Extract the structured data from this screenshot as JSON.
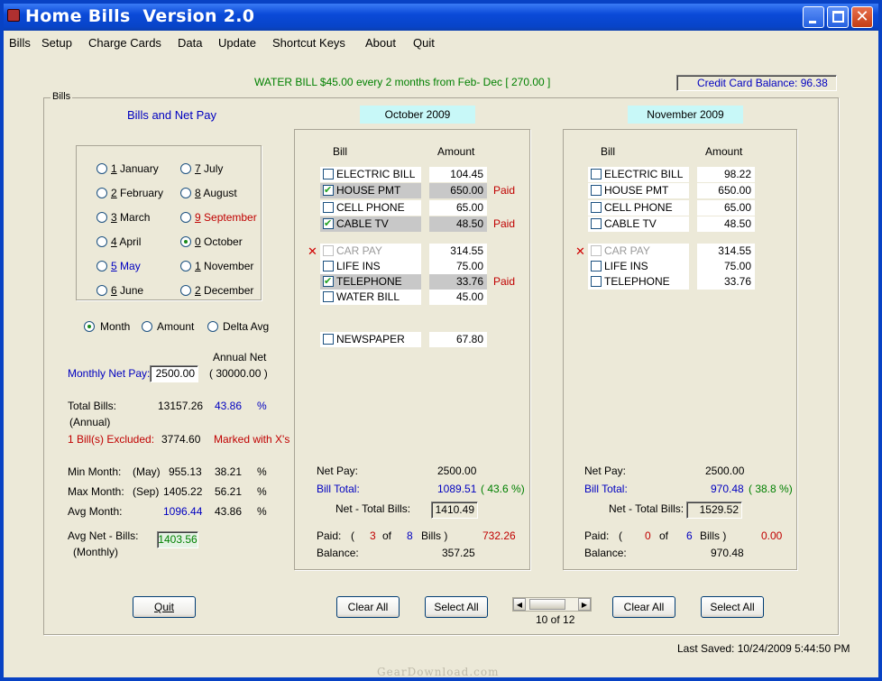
{
  "window": {
    "title": "Home Bills  Version 2.0"
  },
  "menu": [
    "Bills",
    "Setup",
    "Charge Cards",
    "Data",
    "Update",
    "Shortcut Keys",
    "About",
    "Quit"
  ],
  "reminder": "WATER BILL  $45.00  every 2 months from  Feb- Dec   [ 270.00 ]",
  "credit_card": "Credit Card Balance:  96.38",
  "bills_group_label": "Bills",
  "left": {
    "heading": "Bills and Net Pay",
    "months": [
      {
        "num": "1",
        "label": " January"
      },
      {
        "num": "2",
        "label": " February"
      },
      {
        "num": "3",
        "label": " March"
      },
      {
        "num": "4",
        "label": " April"
      },
      {
        "num": "5",
        "label": " May"
      },
      {
        "num": "6",
        "label": " June"
      },
      {
        "num": "7",
        "label": " July"
      },
      {
        "num": "8",
        "label": " August"
      },
      {
        "num": "9",
        "label": " September"
      },
      {
        "num": "0",
        "label": " October"
      },
      {
        "num": "1",
        "label": " November"
      },
      {
        "num": "2",
        "label": " December"
      }
    ],
    "sort_options": [
      "Month",
      "Amount",
      "Delta Avg"
    ],
    "annual_net_label": "Annual Net",
    "monthly_net_label": "Monthly Net Pay:",
    "monthly_net_value": "2500.00",
    "annual_net_value": "( 30000.00  )",
    "total_bills_label": "Total Bills:",
    "total_bills_sub": "(Annual)",
    "total_bills_value": "13157.26",
    "total_bills_pct": "43.86",
    "pct": "%",
    "excluded_label": "1 Bill(s) Excluded:",
    "excluded_value": "3774.60",
    "excluded_note": "Marked with X's",
    "min_label": "Min Month:",
    "min_month": "(May)",
    "min_value": "955.13",
    "min_pct": "38.21",
    "max_label": "Max Month:",
    "max_month": "(Sep)",
    "max_value": "1405.22",
    "max_pct": "56.21",
    "avg_label": "Avg Month:",
    "avg_value": "1096.44",
    "avg_pct": "43.86",
    "avgnet_label": "Avg Net - Bills:",
    "avgnet_sub": "(Monthly)",
    "avgnet_value": "1403.56",
    "quit": "Quit"
  },
  "oct": {
    "header": "October 2009",
    "col_bill": "Bill",
    "col_amount": "Amount",
    "bills": [
      {
        "name": "ELECTRIC BILL",
        "amount": "104.45",
        "paid": ""
      },
      {
        "name": "HOUSE PMT",
        "amount": "650.00",
        "paid": "Paid"
      },
      {
        "name": "CELL PHONE",
        "amount": "65.00",
        "paid": ""
      },
      {
        "name": "CABLE TV",
        "amount": "48.50",
        "paid": "Paid"
      },
      {
        "name": "CAR PAY",
        "amount": "314.55",
        "paid": "",
        "x": "✕"
      },
      {
        "name": "LIFE INS",
        "amount": "75.00",
        "paid": ""
      },
      {
        "name": "TELEPHONE",
        "amount": "33.76",
        "paid": "Paid"
      },
      {
        "name": "WATER BILL",
        "amount": "45.00",
        "paid": ""
      },
      {
        "name": "NEWSPAPER",
        "amount": "67.80",
        "paid": ""
      }
    ],
    "netpay_label": "Net Pay:",
    "netpay": "2500.00",
    "billtotal_label": "Bill Total:",
    "billtotal": "1089.51",
    "billtotal_pct": "( 43.6  %)",
    "nettotal_label": "Net - Total Bills:",
    "nettotal": "1410.49",
    "paid_label": "Paid:",
    "paid_open": "(",
    "paid_count": "3",
    "of": "of",
    "total_count": "8",
    "bills_close": "Bills )",
    "paid_amount": "732.26",
    "balance_label": "Balance:",
    "balance": "357.25",
    "clear_all": "Clear All",
    "select_all": "Select All"
  },
  "nov": {
    "header": "November 2009",
    "col_bill": "Bill",
    "col_amount": "Amount",
    "bills": [
      {
        "name": "ELECTRIC BILL",
        "amount": "98.22"
      },
      {
        "name": "HOUSE PMT",
        "amount": "650.00"
      },
      {
        "name": "CELL PHONE",
        "amount": "65.00"
      },
      {
        "name": "CABLE TV",
        "amount": "48.50"
      },
      {
        "name": "CAR PAY",
        "amount": "314.55",
        "x": "✕"
      },
      {
        "name": "LIFE INS",
        "amount": "75.00"
      },
      {
        "name": "TELEPHONE",
        "amount": "33.76"
      }
    ],
    "netpay_label": "Net Pay:",
    "netpay": "2500.00",
    "billtotal_label": "Bill Total:",
    "billtotal": "970.48",
    "billtotal_pct": "( 38.8  %)",
    "nettotal_label": "Net - Total Bills:",
    "nettotal": "1529.52",
    "paid_label": "Paid:",
    "paid_open": "(",
    "paid_count": "0",
    "of": "of",
    "total_count": "6",
    "bills_close": "Bills )",
    "paid_amount": "0.00",
    "balance_label": "Balance:",
    "balance": "970.48",
    "clear_all": "Clear All",
    "select_all": "Select All"
  },
  "pager": "10 of 12",
  "last_saved": "Last Saved:  10/24/2009 5:44:50 PM",
  "watermark": "GearDownload.com"
}
